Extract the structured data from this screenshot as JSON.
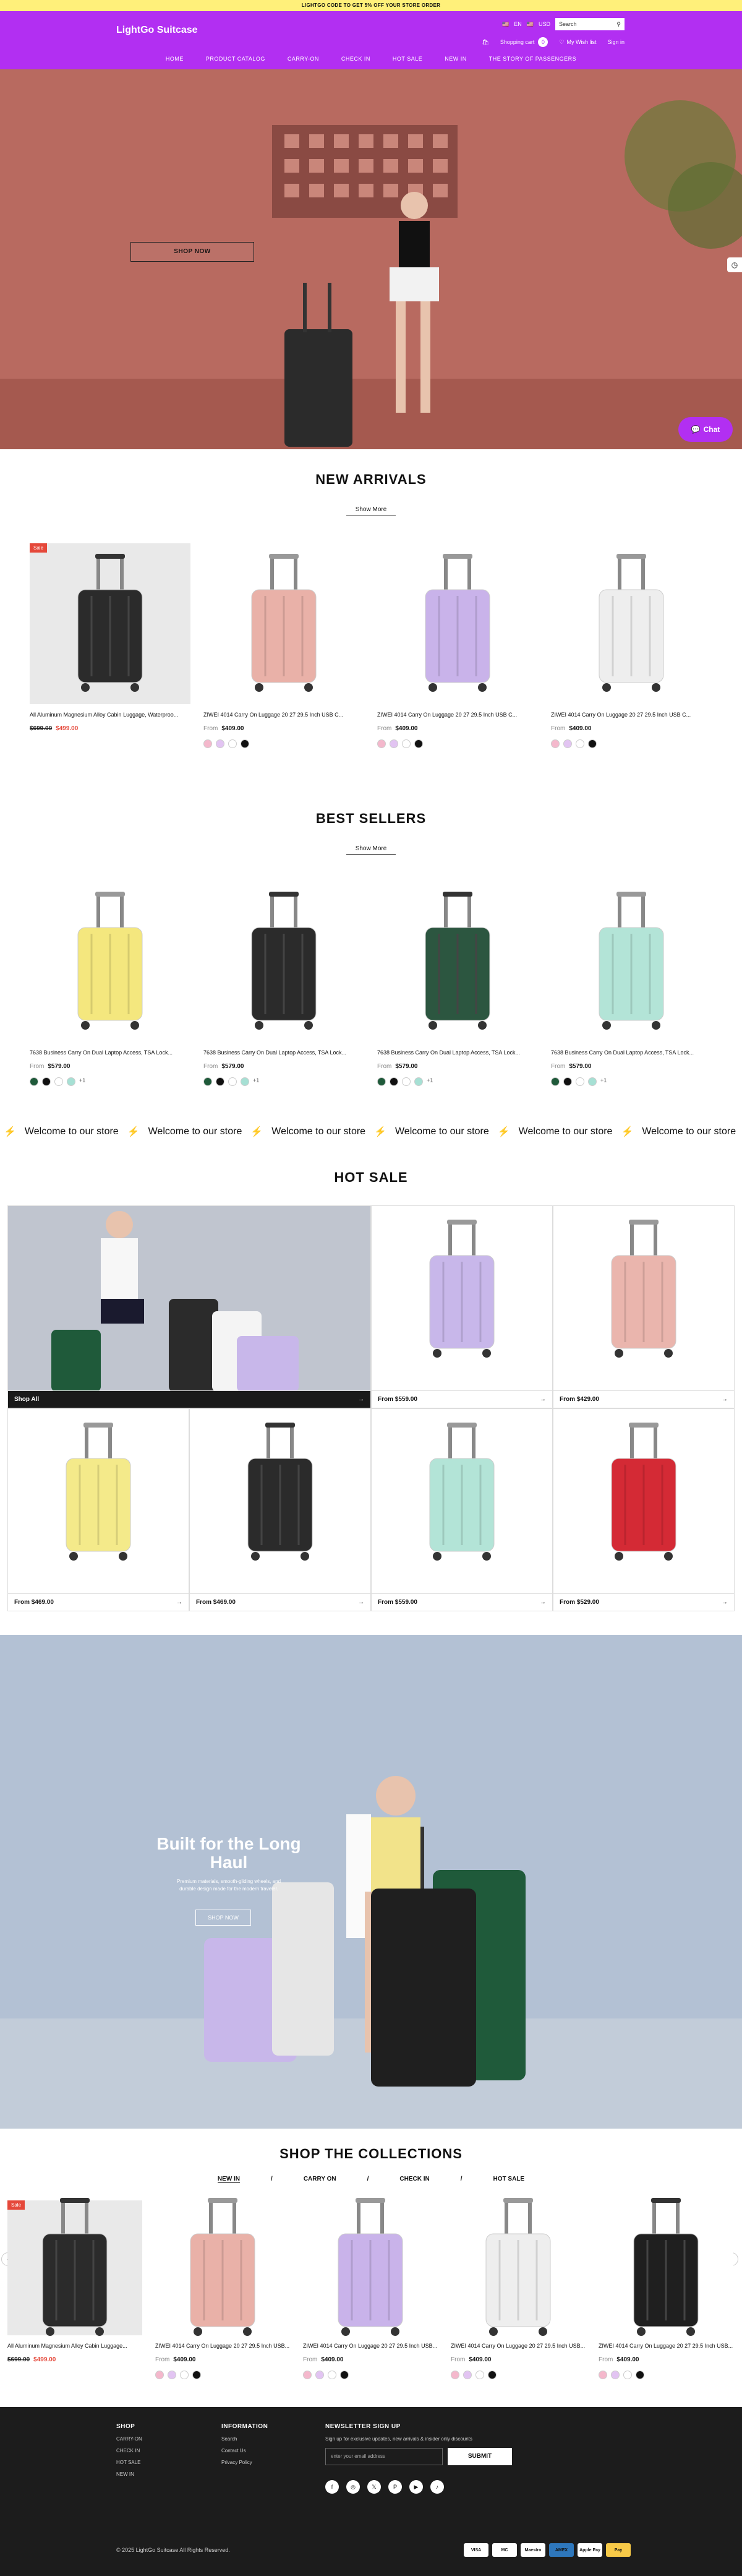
{
  "announcement": "LIGHTGO CODE TO GET 5% OFF YOUR STORE ORDER",
  "header": {
    "logo": "LightGo Suitcase",
    "lang": "EN",
    "currency": "USD",
    "search_placeholder": "Search",
    "cart": "Shopping cart",
    "cart_count": "0",
    "wishlist": "My Wish list",
    "signin": "Sign in",
    "nav": [
      "HOME",
      "PRODUCT CATALOG",
      "CARRY-ON",
      "CHECK IN",
      "HOT SALE",
      "NEW IN",
      "THE STORY OF PASSENGERS"
    ],
    "colors": {
      "brand": "#b22ff2",
      "announcement": "#fff07a"
    }
  },
  "hero": {
    "button": "SHOP NOW",
    "chat": "Chat"
  },
  "new_arrivals": {
    "title": "NEW ARRIVALS",
    "more": "Show More",
    "products": [
      {
        "badge": "Sale",
        "title": "All Aluminum Magnesium Alloy Cabin Luggage, Waterproo...",
        "old": "$699.00",
        "price": "$499.00",
        "swatches": [],
        "color": "#2b2b2b"
      },
      {
        "title": "ZIWEI 4014 Carry On Luggage 20 27 29.5 Inch USB C...",
        "from": "From",
        "price": "$409.00",
        "swatches": [
          "#f4b8cc",
          "#e2c4f2",
          "#ffffff",
          "#111111"
        ],
        "color": "#e9b1a8"
      },
      {
        "title": "ZIWEI 4014 Carry On Luggage 20 27 29.5 Inch USB C...",
        "from": "From",
        "price": "$409.00",
        "swatches": [
          "#f4b8cc",
          "#e2c4f2",
          "#ffffff",
          "#111111"
        ],
        "color": "#c9b3ea"
      },
      {
        "title": "ZIWEI 4014 Carry On Luggage 20 27 29.5 Inch USB C...",
        "from": "From",
        "price": "$409.00",
        "swatches": [
          "#f4b8cc",
          "#e2c4f2",
          "#ffffff",
          "#111111"
        ],
        "color": "#eeeeee"
      }
    ]
  },
  "best_sellers": {
    "title": "BEST SELLERS",
    "more": "Show More",
    "products": [
      {
        "title": "7638 Business Carry On Dual Laptop Access, TSA Lock...",
        "from": "From",
        "price": "$579.00",
        "swatches": [
          "#1f5a3a",
          "#111111",
          "#ffffff",
          "#a6e0d4"
        ],
        "more": "+1",
        "color": "#f4e77e"
      },
      {
        "title": "7638 Business Carry On Dual Laptop Access, TSA Lock...",
        "from": "From",
        "price": "$579.00",
        "swatches": [
          "#1f5a3a",
          "#111111",
          "#ffffff",
          "#a6e0d4"
        ],
        "more": "+1",
        "color": "#2b2b2b"
      },
      {
        "title": "7638 Business Carry On Dual Laptop Access, TSA Lock...",
        "from": "From",
        "price": "$579.00",
        "swatches": [
          "#1f5a3a",
          "#111111",
          "#ffffff",
          "#a6e0d4"
        ],
        "more": "+1",
        "color": "#2c5640"
      },
      {
        "title": "7638 Business Carry On Dual Laptop Access, TSA Lock...",
        "from": "From",
        "price": "$579.00",
        "swatches": [
          "#1f5a3a",
          "#111111",
          "#ffffff",
          "#a6e0d4"
        ],
        "more": "+1",
        "color": "#b3e4d7"
      }
    ]
  },
  "ticker": {
    "text": "Welcome to our store",
    "count": 7
  },
  "hot_sale": {
    "title": "HOT SALE",
    "cells": [
      {
        "label": "Shop All",
        "color": "#c0c5cf"
      },
      {
        "label": "From $559.00",
        "color": "#c8b7ea"
      },
      {
        "label": "From $429.00",
        "color": "#eab5ad"
      },
      {
        "label": "From $469.00",
        "color": "#f4ea8a"
      },
      {
        "label": "From $469.00",
        "color": "#2b2b2b"
      },
      {
        "label": "From $559.00",
        "color": "#b3e4d7"
      },
      {
        "label": "From $529.00",
        "color": "#d42a35"
      }
    ]
  },
  "banner": {
    "title": "Built for the Long Haul",
    "sub": "Premium materials, smooth-gliding wheels, and durable design made for the modern traveler.",
    "button": "SHOP NOW"
  },
  "collections": {
    "title": "SHOP THE COLLECTIONS",
    "tabs": [
      "NEW IN",
      "CARRY ON",
      "CHECK IN",
      "HOT SALE"
    ],
    "products": [
      {
        "badge": "Sale",
        "title": "All Aluminum Magnesium Alloy Cabin Luggage...",
        "old": "$699.00",
        "price": "$499.00",
        "swatches": [],
        "color": "#2b2b2b"
      },
      {
        "title": "ZIWEI 4014 Carry On Luggage 20 27 29.5 Inch USB...",
        "from": "From",
        "price": "$409.00",
        "swatches": [
          "#f4b8cc",
          "#e2c4f2",
          "#ffffff",
          "#111111"
        ],
        "color": "#e9b1a8"
      },
      {
        "title": "ZIWEI 4014 Carry On Luggage 20 27 29.5 Inch USB...",
        "from": "From",
        "price": "$409.00",
        "swatches": [
          "#f4b8cc",
          "#e2c4f2",
          "#ffffff",
          "#111111"
        ],
        "color": "#c9b3ea"
      },
      {
        "title": "ZIWEI 4014 Carry On Luggage 20 27 29.5 Inch USB...",
        "from": "From",
        "price": "$409.00",
        "swatches": [
          "#f4b8cc",
          "#e2c4f2",
          "#ffffff",
          "#111111"
        ],
        "color": "#eeeeee"
      },
      {
        "title": "ZIWEI 4014 Carry On Luggage 20 27 29.5 Inch USB...",
        "from": "From",
        "price": "$409.00",
        "swatches": [
          "#f4b8cc",
          "#e2c4f2",
          "#ffffff",
          "#111111"
        ],
        "color": "#1f1f1f"
      }
    ]
  },
  "footer": {
    "shop_title": "SHOP",
    "shop_links": [
      "CARRY-ON",
      "CHECK IN",
      "HOT SALE",
      "NEW IN"
    ],
    "info_title": "INFORMATION",
    "info_links": [
      "Search",
      "Contact Us",
      "Privacy Policy"
    ],
    "news_title": "NEWSLETTER SIGN UP",
    "news_text": "Sign up for exclusive updates, new arrivals & insider only discounts",
    "email_placeholder": "enter your email address",
    "submit": "SUBMIT",
    "social": [
      "facebook-icon",
      "instagram-icon",
      "twitter-icon",
      "pinterest-icon",
      "youtube-icon",
      "tiktok-icon"
    ],
    "copyright": "© 2025 LightGo Suitcase All Rights Reserved.",
    "payments": [
      "VISA",
      "MC",
      "Maestro",
      "AMEX",
      "Apple Pay",
      "Pay"
    ]
  }
}
